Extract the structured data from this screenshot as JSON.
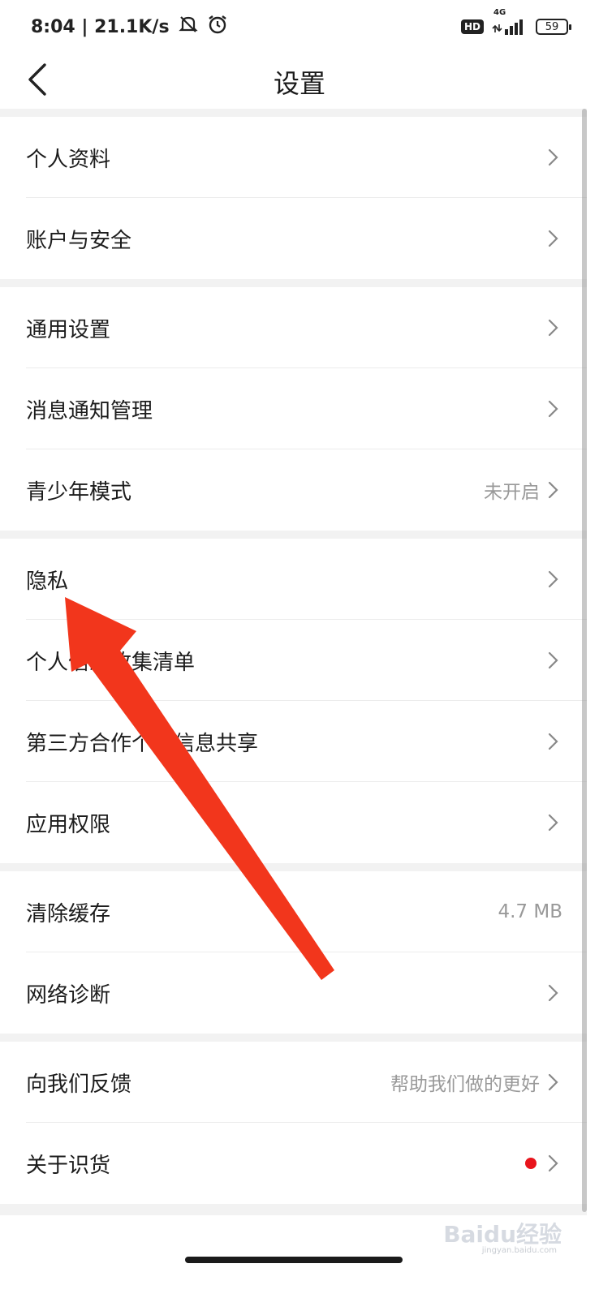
{
  "status_bar": {
    "time_speed": "8:04 | 21.1K/s",
    "hd": "HD",
    "network": "4G",
    "battery": "59",
    "icons": [
      "mute-icon",
      "alarm-icon",
      "signal-icon"
    ]
  },
  "nav": {
    "title": "设置",
    "back_icon": "chevron-left-icon"
  },
  "sections": [
    [
      {
        "label": "个人资料",
        "value": ""
      },
      {
        "label": "账户与安全",
        "value": ""
      }
    ],
    [
      {
        "label": "通用设置",
        "value": ""
      },
      {
        "label": "消息通知管理",
        "value": ""
      },
      {
        "label": "青少年模式",
        "value": "未开启"
      }
    ],
    [
      {
        "label": "隐私",
        "value": ""
      },
      {
        "label": "个人信息收集清单",
        "value": ""
      },
      {
        "label": "第三方合作个人信息共享",
        "value": ""
      },
      {
        "label": "应用权限",
        "value": ""
      }
    ],
    [
      {
        "label": "清除缓存",
        "value": "4.7 MB"
      },
      {
        "label": "网络诊断",
        "value": ""
      }
    ],
    [
      {
        "label": "向我们反馈",
        "value": "帮助我们做的更好"
      },
      {
        "label": "关于识货",
        "value": ""
      }
    ]
  ],
  "colors": {
    "annotation_arrow": "#f2361c",
    "red_dot": "#e8141c",
    "section_gap": "#f2f2f2"
  },
  "watermark": {
    "text": "Baidu经验",
    "sub": "jingyan.baidu.com"
  }
}
